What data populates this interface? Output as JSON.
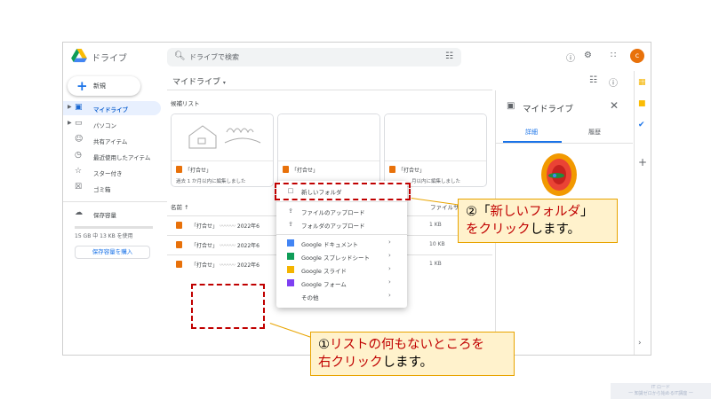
{
  "header": {
    "app_title": "ドライブ",
    "search_placeholder": "ドライブで検索",
    "avatar_letter": "c",
    "icons": [
      "help-icon",
      "settings-icon",
      "apps-icon"
    ]
  },
  "sidebar": {
    "new_label": "新規",
    "items": [
      {
        "label": "マイドライブ",
        "icon": "my-drive-icon",
        "active": true
      },
      {
        "label": "パソコン",
        "icon": "computer-icon"
      },
      {
        "label": "共有アイテム",
        "icon": "shared-icon"
      },
      {
        "label": "最近使用したアイテム",
        "icon": "clock-icon"
      },
      {
        "label": "スター付き",
        "icon": "star-icon"
      },
      {
        "label": "ゴミ箱",
        "icon": "trash-icon"
      },
      {
        "label": "保存容量",
        "icon": "cloud-icon"
      }
    ],
    "storage_text": "15 GB 中 13 KB を使用",
    "buy_storage_label": "保存容量を購入"
  },
  "main": {
    "title": "マイドライブ",
    "section_label": "候補リスト",
    "cards": [
      {
        "name": "「打合せ」",
        "sub": "過去 1 か月以内に編集しました"
      },
      {
        "name": "「打合せ」",
        "sub": ""
      },
      {
        "name": "「打合せ」",
        "sub": "月以内に編集しました"
      }
    ],
    "list_header_name": "名前",
    "list_header_sort": "↑",
    "list_header_owner": "ファイルサ",
    "rows": [
      {
        "name": "「打合せ」",
        "date": "2022年6",
        "size": "1 KB"
      },
      {
        "name": "「打合せ」",
        "date": "2022年6",
        "size": "10 KB"
      },
      {
        "name": "「打合せ」",
        "date": "2022年6",
        "size": "1 KB"
      }
    ]
  },
  "details": {
    "title": "マイドライブ",
    "tab_details": "詳細",
    "tab_activity": "履歴"
  },
  "context_menu": {
    "items": [
      {
        "label": "新しいフォルダ",
        "icon": "new-folder-icon"
      },
      {
        "label": "ファイルのアップロード",
        "icon": "file-upload-icon"
      },
      {
        "label": "フォルダのアップロード",
        "icon": "folder-upload-icon"
      },
      {
        "label": "Google ドキュメント",
        "icon": "docs-icon",
        "color": "#4285f4",
        "submenu": true
      },
      {
        "label": "Google スプレッドシート",
        "icon": "sheets-icon",
        "color": "#0f9d58",
        "submenu": true
      },
      {
        "label": "Google スライド",
        "icon": "slides-icon",
        "color": "#f4b400",
        "submenu": true
      },
      {
        "label": "Google フォーム",
        "icon": "forms-icon",
        "color": "#7e3ff2",
        "submenu": true
      },
      {
        "label": "その他",
        "icon": "more-icon",
        "submenu": true
      }
    ]
  },
  "callouts": {
    "step2_line1_prefix": "②「",
    "step2_line1_red": "新しいフォルダ",
    "step2_line1_suffix": "」",
    "step2_line2_red": "をクリック",
    "step2_line2_suffix": "します。",
    "step1_line1_prefix": "①",
    "step1_line1_red": "リストの何もないところを",
    "step1_line2_red": "右クリック",
    "step1_line2_suffix": "します。"
  },
  "footer": {
    "brand_line1": "IT ロード",
    "brand_line2": "一 知識ゼロから始めるIT講座 一"
  },
  "colors": {
    "accent": "#1a73e8",
    "highlight": "#c00000",
    "callout_bg": "#fff2cc",
    "callout_border": "#e8a400"
  }
}
